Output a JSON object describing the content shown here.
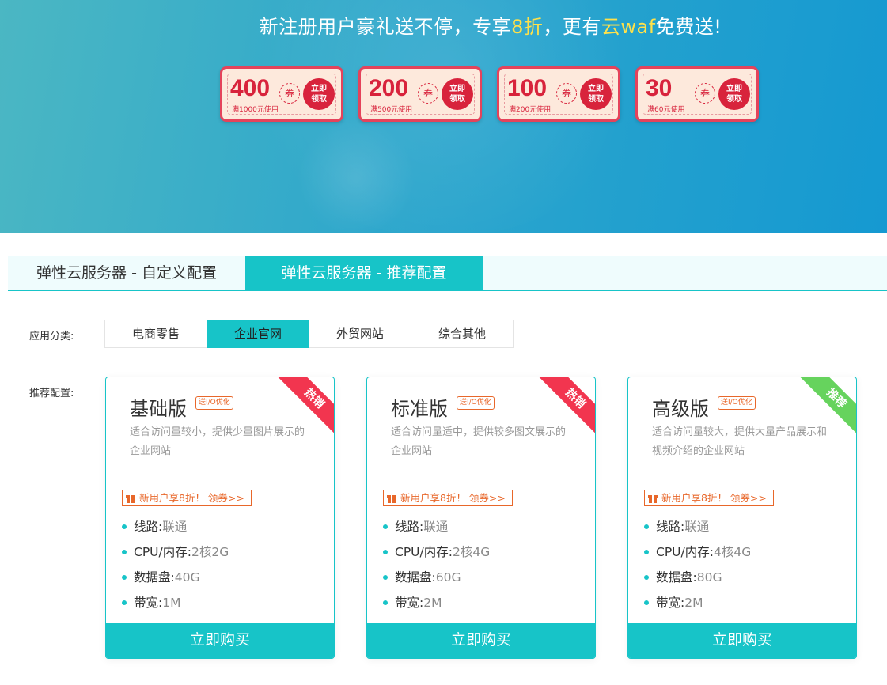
{
  "banner": {
    "headline_p1": "新注册用户豪礼送不停，专享",
    "headline_hl1": "8折",
    "headline_p2": "，更有",
    "headline_hl2": "云waf",
    "headline_p3": "免费送!",
    "coupons": [
      {
        "amount": "400",
        "juan": "券",
        "condition": "满1000元使用",
        "get1": "立即",
        "get2": "领取"
      },
      {
        "amount": "200",
        "juan": "券",
        "condition": "满500元使用",
        "get1": "立即",
        "get2": "领取"
      },
      {
        "amount": "100",
        "juan": "券",
        "condition": "满200元使用",
        "get1": "立即",
        "get2": "领取"
      },
      {
        "amount": "30",
        "juan": "券",
        "condition": "满60元使用",
        "get1": "立即",
        "get2": "领取"
      }
    ]
  },
  "tabs": [
    {
      "label": "弹性云服务器 - 自定义配置",
      "active": false
    },
    {
      "label": "弹性云服务器 - 推荐配置",
      "active": true
    }
  ],
  "category": {
    "label": "应用分类:",
    "options": [
      "电商零售",
      "企业官网",
      "外贸网站",
      "综合其他"
    ],
    "selected": "企业官网"
  },
  "recommend_label": "推荐配置:",
  "plans": [
    {
      "title": "基础版",
      "tag": "送I/O优化",
      "ribbon": "热销",
      "ribbon_color": "#f2354f",
      "desc": "适合访问量较小，提供少量图片展示的企业网站",
      "promo": "新用户享8折！ 领券>>",
      "specs": [
        {
          "k": "线路:",
          "v": "联通"
        },
        {
          "k": "CPU/内存:",
          "v": "2核2G"
        },
        {
          "k": "数据盘:",
          "v": "40G"
        },
        {
          "k": "带宽:",
          "v": "1M"
        }
      ],
      "buy": "立即购买"
    },
    {
      "title": "标准版",
      "tag": "送I/O优化",
      "ribbon": "热销",
      "ribbon_color": "#f2354f",
      "desc": "适合访问量适中，提供较多图文展示的企业网站",
      "promo": "新用户享8折！ 领券>>",
      "specs": [
        {
          "k": "线路:",
          "v": "联通"
        },
        {
          "k": "CPU/内存:",
          "v": "2核4G"
        },
        {
          "k": "数据盘:",
          "v": "60G"
        },
        {
          "k": "带宽:",
          "v": "2M"
        }
      ],
      "buy": "立即购买"
    },
    {
      "title": "高级版",
      "tag": "送I/O优化",
      "ribbon": "推荐",
      "ribbon_color": "#66d35d",
      "desc": "适合访问量较大，提供大量产品展示和视频介绍的企业网站",
      "promo": "新用户享8折！ 领券>>",
      "specs": [
        {
          "k": "线路:",
          "v": "联通"
        },
        {
          "k": "CPU/内存:",
          "v": "4核4G"
        },
        {
          "k": "数据盘:",
          "v": "80G"
        },
        {
          "k": "带宽:",
          "v": "2M"
        }
      ],
      "buy": "立即购买"
    }
  ],
  "colors": {
    "accent": "#17c4c8",
    "coupon_red": "#d8233c",
    "promo_orange": "#e8672a",
    "highlight": "#ffe14a"
  }
}
